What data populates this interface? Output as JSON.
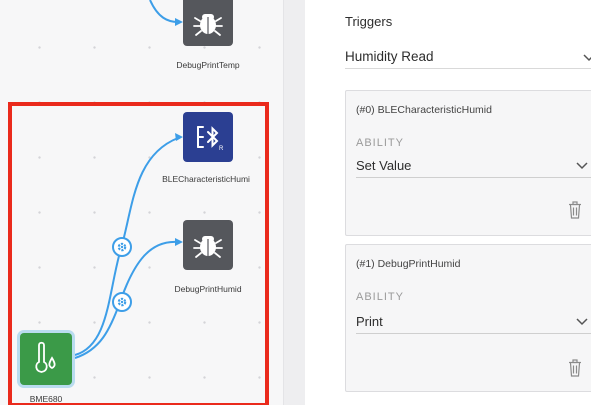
{
  "canvas": {
    "nodes": {
      "debug_temp": {
        "label": "DebugPrintTemp",
        "icon": "bug-icon"
      },
      "ble_humid": {
        "label": "BLECharacteristicHumi",
        "icon": "bluetooth-icon"
      },
      "debug_humid": {
        "label": "DebugPrintHumid",
        "icon": "bug-icon"
      },
      "bme680": {
        "label": "BME680",
        "icon": "humidity-sensor-icon"
      }
    },
    "colors": {
      "wire": "#3d9ee8",
      "selection": "#ea2a1c",
      "sensor_tile": "#3b9a48",
      "ble_tile": "#2b3f92",
      "debug_tile": "#55575c"
    }
  },
  "panel": {
    "triggers_label": "Triggers",
    "trigger_value": "Humidity Read",
    "cards": [
      {
        "title": "(#0) BLECharacteristicHumid",
        "ability_label": "ABILITY",
        "ability_value": "Set Value"
      },
      {
        "title": "(#1) DebugPrintHumid",
        "ability_label": "ABILITY",
        "ability_value": "Print"
      }
    ]
  }
}
